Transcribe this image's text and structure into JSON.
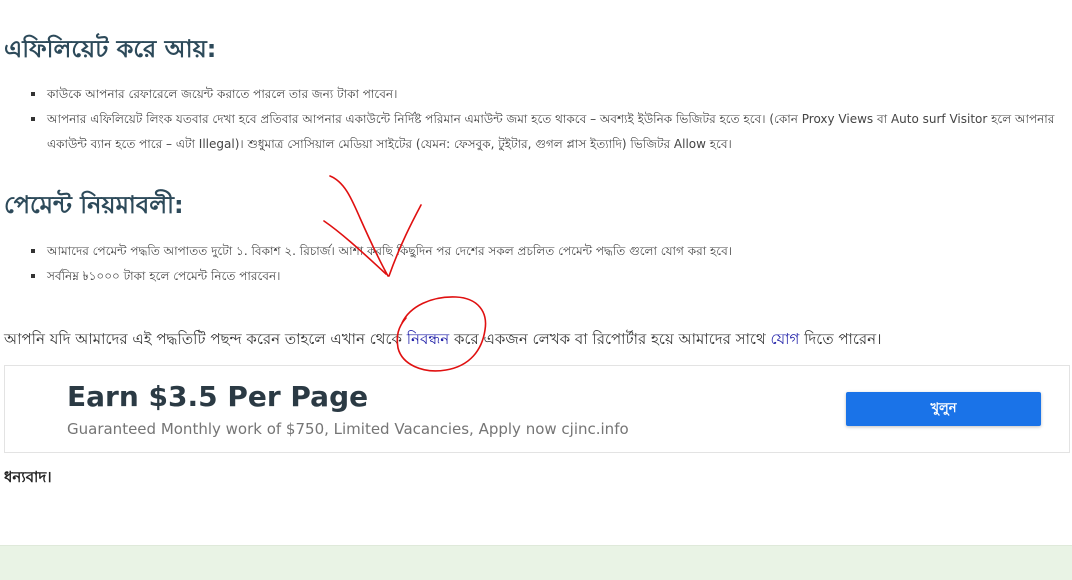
{
  "affiliate": {
    "heading": "এফিলিয়েট করে আয়:",
    "items": [
      "কাউকে আপনার রেফারেলে জয়েন্ট করাতে পারলে তার জন্য টাকা পাবেন।",
      "আপনার এফিলিয়েট লিংক যতবার দেখা হবে প্রতিবার আপনার একাউন্টে নির্দিষ্ট পরিমান এমাউন্ট জমা হতে থাকবে – অবশ্যই ইউনিক ভিজিটর হতে হবে। (কোন Proxy Views বা Auto surf Visitor হলে আপনার একাউন্ট ব্যান হতে পারে – এটা Illegal)। শুধুমাত্র সোসিয়াল মেডিয়া সাইটের (যেমন: ফেসবুক, টুইটার, গুগল প্লাস ইত্যাদি) ভিজিটর Allow হবে।"
    ]
  },
  "payment": {
    "heading": "পেমেন্ট নিয়মাবলী:",
    "items": [
      "আমাদের পেমেন্ট পদ্ধতি আপাতত দুটো ১. বিকাশ ২. রিচার্জ। আশা করছি কিছুদিন পর দেশের সকল প্রচলিত পেমেন্ট পদ্ধতি গুলো যোগ করা হবে।",
      "সর্বনিম্ন ৳১০০০ টাকা হলে পেমেন্ট নিতে পারবেন।"
    ]
  },
  "paragraph": {
    "part1": "আপনি যদি আমাদের এই পদ্ধতিটি পছন্দ করেন তাহলে এখান থেকে ",
    "link_register": "নিবন্ধন",
    "part2": " করে একজন লেখক বা রিপোর্টার হয়ে আমাদের সাথে ",
    "link_join": "যোগ",
    "part3": " দিতে পারেন।"
  },
  "ad": {
    "title": "Earn $3.5 Per Page",
    "subtitle": "Guaranteed Monthly work of $750, Limited Vacancies, Apply now cjinc.info",
    "button": "খুলুন"
  },
  "thanks": "ধন্যবাদ।",
  "colors": {
    "heading": "#2d4a5a",
    "link": "#1a1aa6",
    "ad_button": "#1a73e8",
    "annotation": "#e01010",
    "footer": "#e9f3e5"
  }
}
